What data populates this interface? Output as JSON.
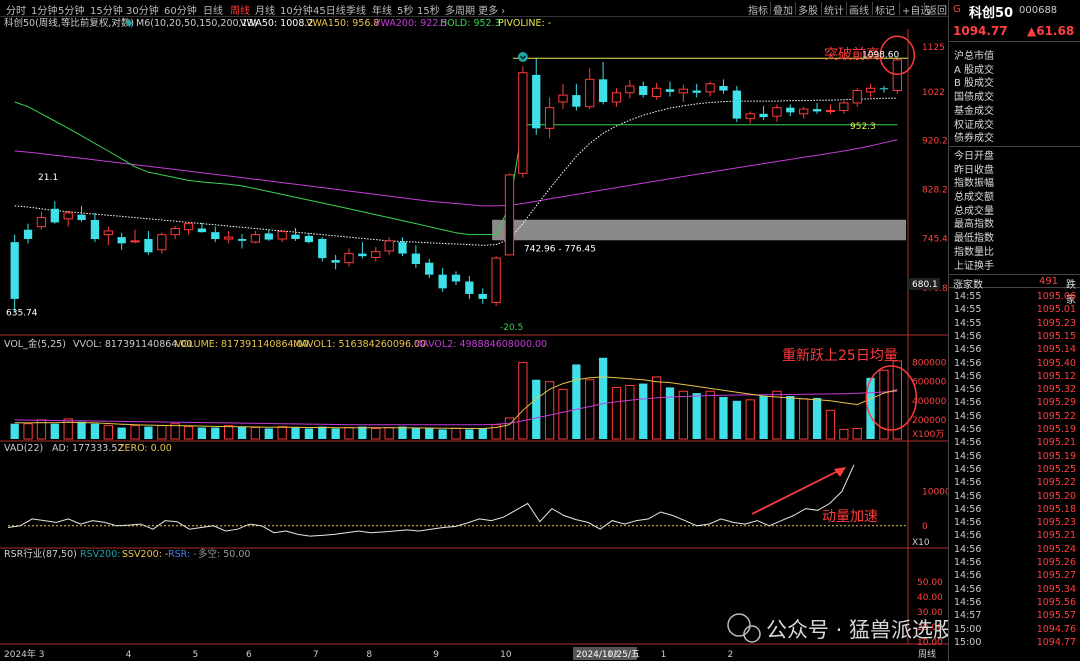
{
  "toolbar": {
    "timeframes": [
      "分时",
      "1分钟",
      "5分钟",
      "15分钟",
      "30分钟",
      "60分钟",
      "日线",
      "周线",
      "月线",
      "10分钟",
      "45日线",
      "季线",
      "年线",
      "5秒",
      "15秒",
      "多周期",
      "更多 ›"
    ],
    "active_timeframe": "周线",
    "buttons": [
      "指标",
      "叠加",
      "多股",
      "统计",
      "画线",
      "标记",
      "+自选",
      "返回"
    ]
  },
  "header": {
    "title": "科创50(周线,等比前复权,对数)",
    "indicators": [
      {
        "text": "M6(10,20,50,150,200,13)",
        "color": "#cccccc"
      },
      {
        "text": "VWA50: 1008.2",
        "color": "#ffffff"
      },
      {
        "text": "VWA150: 956.8",
        "color": "#e8c34a"
      },
      {
        "text": "VWA200: 922.5",
        "color": "#c43bd6"
      },
      {
        "text": "HOLD: 952.3",
        "color": "#39d353"
      },
      {
        "text": "PIVOLINE: -",
        "color": "#e8e84a"
      }
    ]
  },
  "price_axis": {
    "labels": [
      "1125",
      "1022",
      "920.2",
      "828.2",
      "745.4",
      "670.8"
    ],
    "current": "680.1"
  },
  "annotations": {
    "breakout": "突破前高",
    "high_price": "1098.60",
    "hold_price": "952.3",
    "gap_range": "742.96 - 776.45",
    "left_high": "21.1",
    "low_price": "635.74",
    "low_change": "-20.5",
    "vol_reclaim": "重新跃上25日均量",
    "momentum": "动量加速"
  },
  "volume_panel": {
    "labels": [
      {
        "text": "VOL_金(5,25)",
        "color": "#cccccc"
      },
      {
        "text": "VVOL: 817391140864.00",
        "color": "#cccccc"
      },
      {
        "text": "VOLUME: 817391140864.00",
        "color": "#e8c34a"
      },
      {
        "text": "MAVOL1: 516384260096.00",
        "color": "#e8c34a"
      },
      {
        "text": "MAVOL2: 498884608000.00",
        "color": "#c43bd6"
      }
    ],
    "axis": [
      "800000",
      "600000",
      "400000",
      "200000"
    ],
    "unit": "X100万"
  },
  "vad_panel": {
    "labels": [
      {
        "text": "VAD(22)",
        "color": "#cccccc"
      },
      {
        "text": "AD: 177333.52",
        "color": "#cccccc"
      },
      {
        "text": "ZERO: 0.00",
        "color": "#e8c34a"
      }
    ],
    "axis": [
      "10000",
      "0"
    ],
    "unit": "X10"
  },
  "rsr_panel": {
    "labels": [
      {
        "text": "RSR行业(87,50)",
        "color": "#cccccc"
      },
      {
        "text": "RSV200: -",
        "color": "#1fa3a3"
      },
      {
        "text": "SSV200: -",
        "color": "#e8c34a"
      },
      {
        "text": "RSR: -",
        "color": "#4a7fe8"
      },
      {
        "text": "多空: 50.00",
        "color": "#999999"
      }
    ],
    "axis": [
      "50.00",
      "40.00",
      "30.00",
      "20.00",
      "10.00"
    ]
  },
  "x_axis": {
    "labels": [
      "2024年 3",
      "4",
      "5",
      "6",
      "7",
      "8",
      "9",
      "10",
      "2024/10/25/五",
      "12",
      "1",
      "2"
    ],
    "period": "周线"
  },
  "watermark": "公众号 · 猛兽派选股",
  "sidebar": {
    "flag": "G",
    "name": "科创50",
    "code": "000688",
    "price": "1094.77",
    "change": "▲61.68",
    "market_items": [
      "沪总市值",
      "A 股成交",
      "B 股成交",
      "国债成交",
      "基金成交",
      "权证成交",
      "债券成交",
      "今日开盘",
      "昨日收盘",
      "指数振幅",
      "总成交额",
      "总成交量",
      "最高指数",
      "最低指数",
      "指数量比",
      "上证换手",
      "涨家数"
    ],
    "advancers": "491",
    "decliners_label": "跌家",
    "ticks": [
      {
        "t": "14:55",
        "p": "1095.06"
      },
      {
        "t": "14:55",
        "p": "1095.01"
      },
      {
        "t": "14:55",
        "p": "1095.23"
      },
      {
        "t": "14:56",
        "p": "1095.15"
      },
      {
        "t": "14:56",
        "p": "1095.14"
      },
      {
        "t": "14:56",
        "p": "1095.40"
      },
      {
        "t": "14:56",
        "p": "1095.12"
      },
      {
        "t": "14:56",
        "p": "1095.32"
      },
      {
        "t": "14:56",
        "p": "1095.29"
      },
      {
        "t": "14:56",
        "p": "1095.22"
      },
      {
        "t": "14:56",
        "p": "1095.19"
      },
      {
        "t": "14:56",
        "p": "1095.21"
      },
      {
        "t": "14:56",
        "p": "1095.19"
      },
      {
        "t": "14:56",
        "p": "1095.25"
      },
      {
        "t": "14:56",
        "p": "1095.22"
      },
      {
        "t": "14:56",
        "p": "1095.20"
      },
      {
        "t": "14:56",
        "p": "1095.18"
      },
      {
        "t": "14:56",
        "p": "1095.23"
      },
      {
        "t": "14:56",
        "p": "1095.21"
      },
      {
        "t": "14:56",
        "p": "1095.24"
      },
      {
        "t": "14:56",
        "p": "1095.26"
      },
      {
        "t": "14:56",
        "p": "1095.27"
      },
      {
        "t": "14:56",
        "p": "1095.34"
      },
      {
        "t": "14:56",
        "p": "1095.56"
      },
      {
        "t": "14:57",
        "p": "1095.57"
      },
      {
        "t": "15:00",
        "p": "1094.76"
      },
      {
        "t": "15:00",
        "p": "1094.77"
      }
    ]
  },
  "chart_data": {
    "type": "candlestick",
    "period": "weekly",
    "log_scale": true,
    "price_range": [
      630,
      1150
    ],
    "candles": [
      {
        "o": 740,
        "h": 752,
        "l": 636,
        "c": 655
      },
      {
        "o": 760,
        "h": 770,
        "l": 738,
        "c": 745
      },
      {
        "o": 765,
        "h": 790,
        "l": 760,
        "c": 780
      },
      {
        "o": 795,
        "h": 808,
        "l": 770,
        "c": 772
      },
      {
        "o": 778,
        "h": 792,
        "l": 765,
        "c": 788
      },
      {
        "o": 785,
        "h": 800,
        "l": 773,
        "c": 776
      },
      {
        "o": 776,
        "h": 788,
        "l": 740,
        "c": 745
      },
      {
        "o": 752,
        "h": 765,
        "l": 735,
        "c": 758
      },
      {
        "o": 748,
        "h": 755,
        "l": 728,
        "c": 738
      },
      {
        "o": 742,
        "h": 760,
        "l": 738,
        "c": 742
      },
      {
        "o": 745,
        "h": 758,
        "l": 720,
        "c": 724
      },
      {
        "o": 728,
        "h": 755,
        "l": 722,
        "c": 752
      },
      {
        "o": 752,
        "h": 766,
        "l": 745,
        "c": 762
      },
      {
        "o": 760,
        "h": 772,
        "l": 752,
        "c": 770
      },
      {
        "o": 762,
        "h": 772,
        "l": 755,
        "c": 756
      },
      {
        "o": 756,
        "h": 765,
        "l": 740,
        "c": 745
      },
      {
        "o": 745,
        "h": 758,
        "l": 738,
        "c": 748
      },
      {
        "o": 745,
        "h": 753,
        "l": 730,
        "c": 742
      },
      {
        "o": 740,
        "h": 758,
        "l": 738,
        "c": 752
      },
      {
        "o": 754,
        "h": 760,
        "l": 742,
        "c": 744
      },
      {
        "o": 745,
        "h": 758,
        "l": 740,
        "c": 757
      },
      {
        "o": 752,
        "h": 763,
        "l": 742,
        "c": 745
      },
      {
        "o": 750,
        "h": 755,
        "l": 738,
        "c": 740
      },
      {
        "o": 745,
        "h": 748,
        "l": 710,
        "c": 715
      },
      {
        "o": 712,
        "h": 720,
        "l": 698,
        "c": 708
      },
      {
        "o": 708,
        "h": 730,
        "l": 702,
        "c": 722
      },
      {
        "o": 722,
        "h": 740,
        "l": 715,
        "c": 718
      },
      {
        "o": 716,
        "h": 732,
        "l": 710,
        "c": 725
      },
      {
        "o": 726,
        "h": 748,
        "l": 720,
        "c": 742
      },
      {
        "o": 740,
        "h": 748,
        "l": 718,
        "c": 722
      },
      {
        "o": 722,
        "h": 735,
        "l": 700,
        "c": 706
      },
      {
        "o": 708,
        "h": 714,
        "l": 685,
        "c": 690
      },
      {
        "o": 690,
        "h": 700,
        "l": 665,
        "c": 670
      },
      {
        "o": 690,
        "h": 695,
        "l": 675,
        "c": 680
      },
      {
        "o": 680,
        "h": 688,
        "l": 655,
        "c": 662
      },
      {
        "o": 662,
        "h": 670,
        "l": 648,
        "c": 655
      },
      {
        "o": 650,
        "h": 718,
        "l": 645,
        "c": 715
      },
      {
        "o": 720,
        "h": 858,
        "l": 720,
        "c": 855
      },
      {
        "o": 858,
        "h": 1080,
        "l": 850,
        "c": 1065
      },
      {
        "o": 1060,
        "h": 1098,
        "l": 932,
        "c": 945
      },
      {
        "o": 945,
        "h": 1010,
        "l": 925,
        "c": 988
      },
      {
        "o": 1000,
        "h": 1040,
        "l": 985,
        "c": 1015
      },
      {
        "o": 1015,
        "h": 1040,
        "l": 982,
        "c": 990
      },
      {
        "o": 990,
        "h": 1075,
        "l": 985,
        "c": 1050
      },
      {
        "o": 1050,
        "h": 1090,
        "l": 995,
        "c": 1000
      },
      {
        "o": 1000,
        "h": 1030,
        "l": 990,
        "c": 1020
      },
      {
        "o": 1020,
        "h": 1048,
        "l": 1008,
        "c": 1035
      },
      {
        "o": 1035,
        "h": 1045,
        "l": 1010,
        "c": 1015
      },
      {
        "o": 1012,
        "h": 1042,
        "l": 1005,
        "c": 1030
      },
      {
        "o": 1028,
        "h": 1045,
        "l": 1012,
        "c": 1022
      },
      {
        "o": 1020,
        "h": 1038,
        "l": 1000,
        "c": 1028
      },
      {
        "o": 1025,
        "h": 1040,
        "l": 1010,
        "c": 1020
      },
      {
        "o": 1022,
        "h": 1045,
        "l": 1012,
        "c": 1040
      },
      {
        "o": 1035,
        "h": 1050,
        "l": 1018,
        "c": 1025
      },
      {
        "o": 1025,
        "h": 1035,
        "l": 958,
        "c": 965
      },
      {
        "o": 965,
        "h": 980,
        "l": 955,
        "c": 975
      },
      {
        "o": 975,
        "h": 992,
        "l": 962,
        "c": 968
      },
      {
        "o": 970,
        "h": 995,
        "l": 958,
        "c": 988
      },
      {
        "o": 988,
        "h": 995,
        "l": 970,
        "c": 978
      },
      {
        "o": 975,
        "h": 990,
        "l": 965,
        "c": 985
      },
      {
        "o": 985,
        "h": 998,
        "l": 975,
        "c": 980
      },
      {
        "o": 980,
        "h": 995,
        "l": 975,
        "c": 982
      },
      {
        "o": 982,
        "h": 1002,
        "l": 975,
        "c": 998
      },
      {
        "o": 998,
        "h": 1030,
        "l": 990,
        "c": 1025
      },
      {
        "o": 1022,
        "h": 1040,
        "l": 1010,
        "c": 1030
      },
      {
        "o": 1030,
        "h": 1035,
        "l": 1020,
        "c": 1028
      },
      {
        "o": 1025,
        "h": 1098.6,
        "l": 1018,
        "c": 1094.77
      }
    ],
    "vwa50": [
      800,
      798,
      795,
      792,
      790,
      788,
      786,
      784,
      782,
      780,
      778,
      776,
      774,
      772,
      770,
      768,
      766,
      764,
      762,
      760,
      758,
      756,
      754,
      752,
      750,
      748,
      746,
      744,
      742,
      741,
      740,
      739,
      738,
      737,
      736,
      735,
      736,
      745,
      770,
      800,
      830,
      860,
      890,
      915,
      935,
      950,
      962,
      972,
      980,
      987,
      992,
      996,
      999,
      1001,
      1002,
      1002,
      1002,
      1002,
      1003,
      1003,
      1004,
      1004,
      1005,
      1006,
      1007,
      1008,
      1008.2
    ],
    "vwa200": [
      900,
      898,
      895,
      892,
      889,
      886,
      883,
      880,
      877,
      874,
      871,
      868,
      865,
      862,
      859,
      856,
      853,
      850,
      847,
      844,
      841,
      838,
      835,
      832,
      829,
      826,
      823,
      820,
      817,
      814,
      811,
      808,
      806,
      804,
      802,
      800,
      800,
      801,
      804,
      808,
      812,
      816,
      820,
      824,
      828,
      832,
      836,
      840,
      844,
      848,
      852,
      856,
      860,
      864,
      868,
      872,
      876,
      880,
      884,
      888,
      892,
      896,
      900,
      905,
      910,
      916,
      922.5
    ],
    "hold": [
      1000,
      990,
      975,
      960,
      945,
      930,
      915,
      900,
      885,
      870,
      860,
      855,
      850,
      845,
      842,
      840,
      838,
      835,
      830,
      825,
      820,
      815,
      810,
      805,
      800,
      795,
      790,
      785,
      780,
      775,
      770,
      765,
      760,
      755,
      752,
      752,
      752,
      800,
      952.3,
      952.3,
      952.3,
      952.3,
      952.3,
      952.3,
      952.3,
      952.3,
      952.3,
      952.3,
      952.3,
      952.3,
      952.3,
      952.3,
      952.3,
      952.3,
      952.3,
      952.3,
      952.3,
      952.3,
      952.3,
      952.3,
      952.3,
      952.3,
      952.3,
      952.3,
      952.3,
      952.3,
      952.3
    ],
    "pivot_high": 1098.6,
    "gap_zone": [
      742.96,
      776.45
    ],
    "volume": {
      "unit": "X100万",
      "ylim": [
        0,
        900000
      ],
      "values": [
        160000,
        160000,
        200000,
        160000,
        210000,
        180000,
        160000,
        140000,
        120000,
        140000,
        130000,
        140000,
        160000,
        130000,
        120000,
        120000,
        140000,
        130000,
        120000,
        110000,
        130000,
        120000,
        110000,
        130000,
        110000,
        120000,
        130000,
        110000,
        120000,
        130000,
        120000,
        110000,
        100000,
        110000,
        100000,
        110000,
        150000,
        220000,
        800000,
        620000,
        600000,
        520000,
        780000,
        620000,
        850000,
        540000,
        560000,
        580000,
        650000,
        540000,
        500000,
        480000,
        500000,
        440000,
        400000,
        410000,
        450000,
        500000,
        450000,
        420000,
        430000,
        300000,
        100000,
        110000,
        640000,
        720000,
        817391
      ],
      "up": [
        false,
        true,
        true,
        false,
        true,
        false,
        false,
        true,
        false,
        true,
        false,
        true,
        true,
        true,
        false,
        false,
        true,
        false,
        true,
        false,
        true,
        false,
        false,
        false,
        false,
        true,
        false,
        true,
        true,
        false,
        false,
        false,
        false,
        true,
        false,
        false,
        true,
        true,
        true,
        false,
        true,
        true,
        false,
        true,
        false,
        true,
        true,
        false,
        true,
        false,
        true,
        false,
        true,
        false,
        false,
        true,
        false,
        true,
        false,
        true,
        false,
        true,
        true,
        true,
        false,
        true,
        true
      ],
      "mavol1": [
        170000,
        168000,
        172000,
        170000,
        175000,
        172000,
        168000,
        162000,
        155000,
        150000,
        145000,
        142000,
        140000,
        138000,
        135000,
        132000,
        130000,
        128000,
        126000,
        124000,
        124000,
        122000,
        120000,
        120000,
        118000,
        118000,
        118000,
        117000,
        117000,
        117000,
        116000,
        115000,
        113000,
        112000,
        110000,
        110000,
        120000,
        150000,
        300000,
        420000,
        520000,
        580000,
        620000,
        640000,
        650000,
        640000,
        630000,
        620000,
        600000,
        590000,
        570000,
        550000,
        530000,
        510000,
        490000,
        470000,
        450000,
        440000,
        430000,
        420000,
        410000,
        400000,
        380000,
        360000,
        420000,
        480000,
        516384
      ],
      "mavol2": [
        200000,
        198000,
        196000,
        194000,
        192000,
        190000,
        188000,
        186000,
        184000,
        182000,
        180000,
        178000,
        176000,
        174000,
        172000,
        170000,
        168000,
        166000,
        164000,
        162000,
        160000,
        158000,
        156000,
        154000,
        152000,
        150000,
        150000,
        150000,
        150000,
        150000,
        150000,
        150000,
        150000,
        150000,
        150000,
        150000,
        155000,
        165000,
        190000,
        220000,
        250000,
        280000,
        310000,
        340000,
        370000,
        390000,
        405000,
        420000,
        430000,
        440000,
        445000,
        450000,
        455000,
        458000,
        460000,
        462000,
        463000,
        465000,
        466000,
        468000,
        470000,
        472000,
        474000,
        478000,
        485000,
        492000,
        498884
      ]
    },
    "vad": {
      "unit": "X10",
      "ylim": [
        -5000,
        20000
      ],
      "values": [
        -500,
        0,
        2000,
        1500,
        1000,
        2000,
        500,
        1500,
        1000,
        0,
        200,
        500,
        -1000,
        1500,
        1200,
        -1000,
        -500,
        0,
        -1500,
        -1000,
        500,
        0,
        -2000,
        -1500,
        -2500,
        -3000,
        -2800,
        -2500,
        -2000,
        -1500,
        -2000,
        -1800,
        -1500,
        -1200,
        -1500,
        -1000,
        -500,
        -200,
        800,
        2000,
        1500,
        2500,
        4500,
        6500,
        1200,
        5000,
        3000,
        1800,
        1000,
        -1000,
        1500,
        500,
        1500,
        2000,
        4000,
        3000,
        1500,
        0,
        500,
        2000,
        1000,
        500,
        1500,
        0,
        1500,
        3000,
        5000,
        4500,
        6500,
        10000,
        17733
      ]
    }
  }
}
